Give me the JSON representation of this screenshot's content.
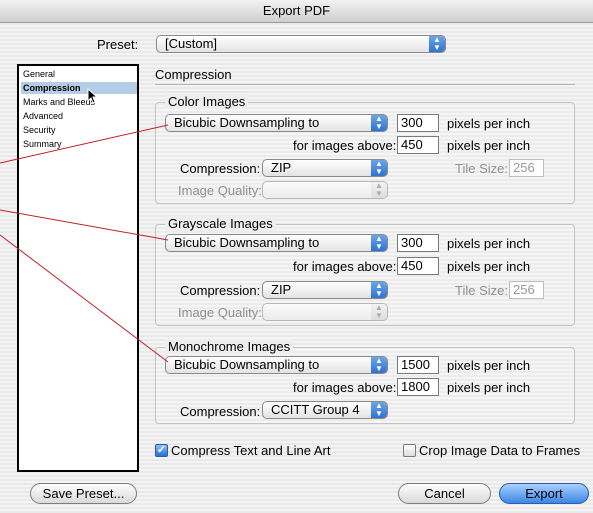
{
  "window": {
    "title": "Export PDF"
  },
  "preset": {
    "label": "Preset:",
    "value": "[Custom]"
  },
  "sidebar": {
    "items": [
      {
        "label": "General",
        "selected": false
      },
      {
        "label": "Compression",
        "selected": true
      },
      {
        "label": "Marks and Bleeds",
        "selected": false
      },
      {
        "label": "Advanced",
        "selected": false
      },
      {
        "label": "Security",
        "selected": false
      },
      {
        "label": "Summary",
        "selected": false
      }
    ]
  },
  "panel": {
    "title": "Compression"
  },
  "color_images": {
    "title": "Color Images",
    "downsampling": "Bicubic Downsampling to",
    "resolution": "300",
    "resolution_unit": "pixels per inch",
    "above_label": "for images above:",
    "above_value": "450",
    "above_unit": "pixels per inch",
    "compression_label": "Compression:",
    "compression_value": "ZIP",
    "tile_label": "Tile Size:",
    "tile_value": "256",
    "quality_label": "Image Quality:",
    "quality_value": ""
  },
  "grayscale_images": {
    "title": "Grayscale Images",
    "downsampling": "Bicubic Downsampling to",
    "resolution": "300",
    "resolution_unit": "pixels per inch",
    "above_label": "for images above:",
    "above_value": "450",
    "above_unit": "pixels per inch",
    "compression_label": "Compression:",
    "compression_value": "ZIP",
    "tile_label": "Tile Size:",
    "tile_value": "256",
    "quality_label": "Image Quality:",
    "quality_value": ""
  },
  "monochrome_images": {
    "title": "Monochrome Images",
    "downsampling": "Bicubic Downsampling to",
    "resolution": "1500",
    "resolution_unit": "pixels per inch",
    "above_label": "for images above:",
    "above_value": "1800",
    "above_unit": "pixels per inch",
    "compression_label": "Compression:",
    "compression_value": "CCITT Group 4"
  },
  "options": {
    "compress_text": {
      "label": "Compress Text and Line Art",
      "checked": true
    },
    "crop_image": {
      "label": "Crop Image Data to Frames",
      "checked": false
    }
  },
  "buttons": {
    "save_preset": "Save Preset...",
    "cancel": "Cancel",
    "export": "Export"
  },
  "icons": {
    "popup_arrows": "▲▼",
    "checkmark": "✓",
    "cursor": "mouse-pointer-icon"
  },
  "colors": {
    "annotation_line": "#c0202a",
    "selection": "#b6cde8",
    "accent": "#3c86e6"
  }
}
